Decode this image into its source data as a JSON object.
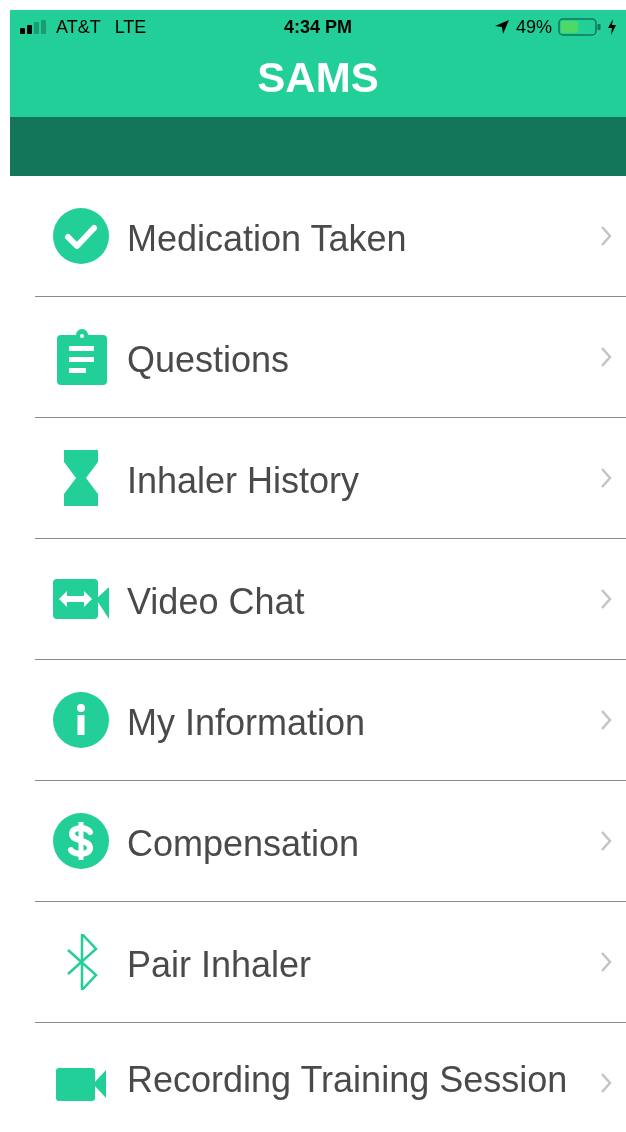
{
  "status_bar": {
    "carrier": "AT&T",
    "network": "LTE",
    "time": "4:34 PM",
    "battery": "49%"
  },
  "header": {
    "title": "SAMS"
  },
  "menu": [
    {
      "label": "Medication Taken"
    },
    {
      "label": "Questions"
    },
    {
      "label": "Inhaler History"
    },
    {
      "label": "Video Chat"
    },
    {
      "label": "My Information"
    },
    {
      "label": "Compensation"
    },
    {
      "label": "Pair Inhaler"
    },
    {
      "label": "Recording Training Session"
    }
  ]
}
